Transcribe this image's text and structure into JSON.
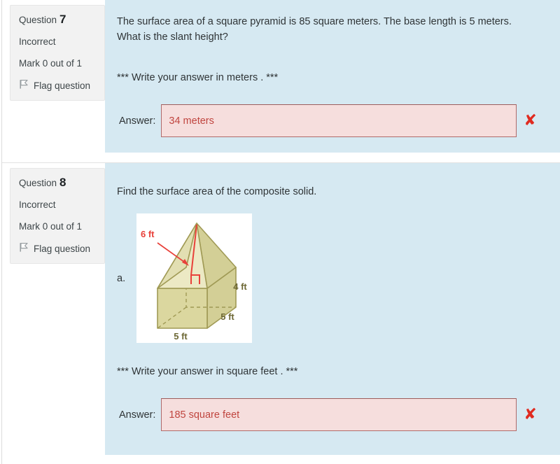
{
  "questions": [
    {
      "header_label": "Question",
      "number": "7",
      "status": "Incorrect",
      "mark": "Mark 0 out of 1",
      "flag_label": "Flag question",
      "flag_icon": "flag-icon",
      "text": "The surface area of a square pyramid is 85 square meters.  The base length is 5 meters.  What is the slant height?",
      "instruction": "*** Write your answer in meters .   ***",
      "answer_label": "Answer:",
      "answer_value": "34 meters",
      "answer_placeholder": "",
      "grade_icon": "incorrect-cross-icon",
      "grade_mark": "✘"
    },
    {
      "header_label": "Question",
      "number": "8",
      "status": "Incorrect",
      "mark": "Mark 0 out of 1",
      "flag_label": "Flag question",
      "flag_icon": "flag-icon",
      "text": "Find the surface area of the composite solid.",
      "figure_letter": "a.",
      "instruction": "*** Write your answer in square feet .   ***",
      "answer_label": "Answer:",
      "answer_value": "185 square feet",
      "answer_placeholder": "",
      "grade_icon": "incorrect-cross-icon",
      "grade_mark": "✘"
    }
  ],
  "figure": {
    "description": "composite solid: square prism with pyramid on top",
    "labels": {
      "slant_height": "6 ft",
      "prism_height": "4 ft",
      "depth": "5 ft",
      "base_width": "5 ft"
    }
  },
  "colors": {
    "question_panel_bg": "#d6e9f2",
    "info_panel_bg": "#f2f2f2",
    "answer_box_bg": "#f6dedd",
    "answer_box_border": "#b06a6a",
    "answer_text": "#c0453f",
    "incorrect_mark": "#e02b20",
    "figure_solid_fill": "#d8d49a",
    "figure_light_fill": "#eceac7",
    "figure_line": "#a09a55",
    "figure_annotation": "#e8413a"
  }
}
